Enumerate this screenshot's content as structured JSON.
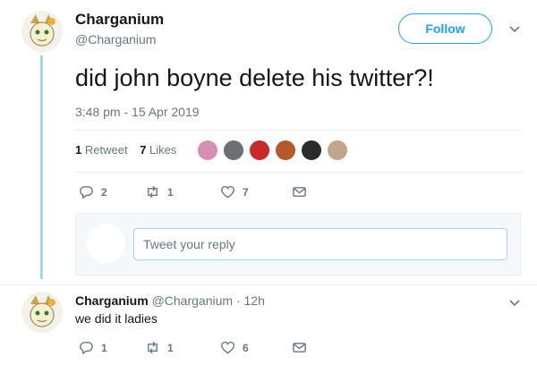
{
  "tweet": {
    "display_name": "Charganium",
    "handle": "@Charganium",
    "follow_label": "Follow",
    "text": "did john boyne delete his twitter?!",
    "timestamp": "3:48 pm - 15 Apr 2019",
    "retweet_count": "1",
    "retweet_label": "Retweet",
    "like_count": "7",
    "like_label": "Likes",
    "actions": {
      "replies": "2",
      "retweets": "1",
      "likes": "7"
    }
  },
  "likers": [
    {
      "color": "#d98fb3"
    },
    {
      "color": "#6c6f73"
    },
    {
      "color": "#c62a2a"
    },
    {
      "color": "#b5582a"
    },
    {
      "color": "#2b2b2b"
    },
    {
      "color": "#c3a58a"
    }
  ],
  "reply_composer": {
    "placeholder": "Tweet your reply"
  },
  "reply": {
    "display_name": "Charganium",
    "handle": "@Charganium",
    "dot": "·",
    "time": "12h",
    "text": "we did it ladies",
    "actions": {
      "replies": "1",
      "retweets": "1",
      "likes": "6"
    }
  },
  "colors": {
    "accent": "#1da1f2",
    "secondary_text": "#657786",
    "thread_line": "#9fd8f6"
  },
  "icons": [
    "reply-icon",
    "retweet-icon",
    "like-icon",
    "message-icon",
    "chevron-down-icon"
  ]
}
